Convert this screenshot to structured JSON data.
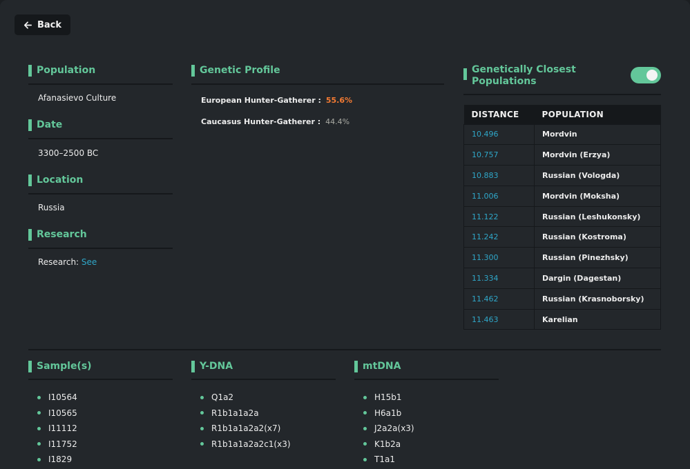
{
  "back_label": "Back",
  "info": [
    {
      "heading": "Population",
      "value": "Afanasievo Culture"
    },
    {
      "heading": "Date",
      "value": "3300–2500 BC"
    },
    {
      "heading": "Location",
      "value": "Russia"
    },
    {
      "heading": "Research",
      "value_prefix": "Research: ",
      "link_label": "See"
    }
  ],
  "genetic_profile": {
    "heading": "Genetic Profile",
    "components": [
      {
        "name": "European Hunter-Gatherer :",
        "percent": "55.6%"
      },
      {
        "name": "Caucasus Hunter-Gatherer :",
        "percent": "44.4%"
      }
    ]
  },
  "closest": {
    "heading": "Genetically Closest Populations",
    "toggle_on": true,
    "columns": [
      "DISTANCE",
      "POPULATION"
    ],
    "rows": [
      {
        "distance": "10.496",
        "population": "Mordvin"
      },
      {
        "distance": "10.757",
        "population": "Mordvin (Erzya)"
      },
      {
        "distance": "10.883",
        "population": "Russian (Vologda)"
      },
      {
        "distance": "11.006",
        "population": "Mordvin (Moksha)"
      },
      {
        "distance": "11.122",
        "population": "Russian (Leshukonsky)"
      },
      {
        "distance": "11.242",
        "population": "Russian (Kostroma)"
      },
      {
        "distance": "11.300",
        "population": "Russian (Pinezhsky)"
      },
      {
        "distance": "11.334",
        "population": "Dargin (Dagestan)"
      },
      {
        "distance": "11.462",
        "population": "Russian (Krasnoborsky)"
      },
      {
        "distance": "11.463",
        "population": "Karelian"
      }
    ]
  },
  "samples": {
    "heading": "Sample(s)",
    "items": [
      "I10564",
      "I10565",
      "I11112",
      "I11752",
      "I1829"
    ]
  },
  "ydna": {
    "heading": "Y-DNA",
    "items": [
      "Q1a2",
      "R1b1a1a2a",
      "R1b1a1a2a2(x7)",
      "R1b1a1a2a2c1(x3)"
    ]
  },
  "mtdna": {
    "heading": "mtDNA",
    "items": [
      "H15b1",
      "H6a1b",
      "J2a2a(x3)",
      "K1b2a",
      "T1a1"
    ]
  },
  "colors": {
    "accent": "#63c79a",
    "link": "#2fa7c9",
    "highlight": "#f47b33",
    "panel": "#23272b"
  },
  "icons": {
    "back": "arrow-left-icon"
  }
}
